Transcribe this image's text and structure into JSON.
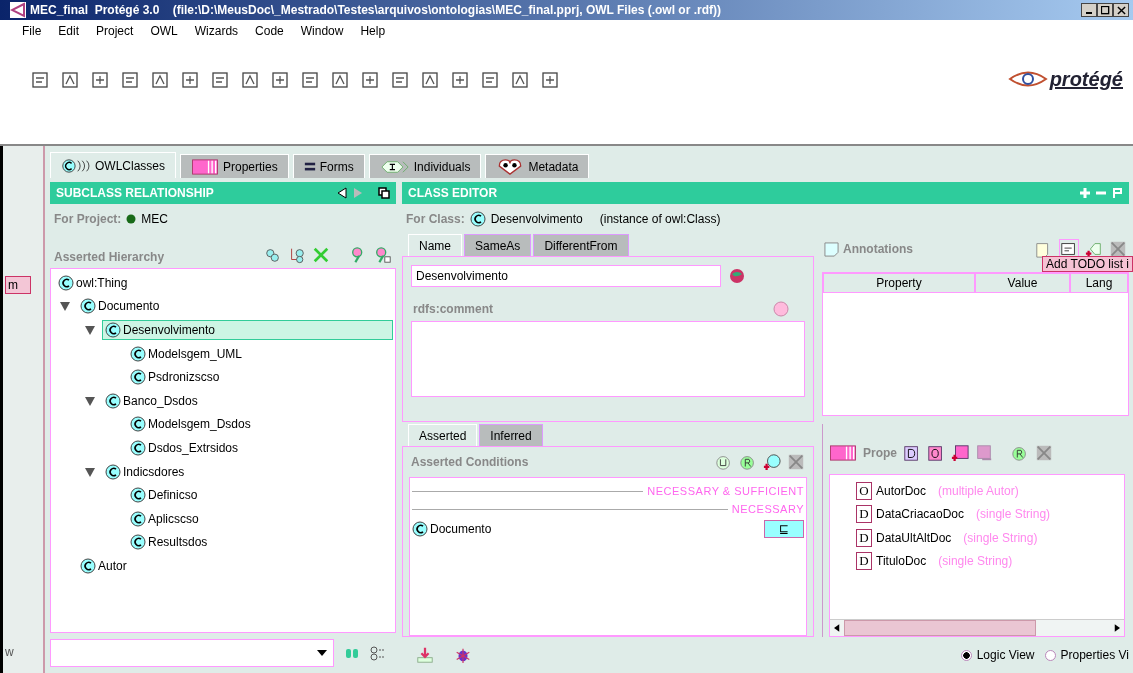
{
  "window": {
    "title": "MEC_final  Protégé 3.0    (file:\\D:\\MeusDoc\\_Mestrado\\Testes\\arquivos\\ontologias\\MEC_final.pprj, OWL Files (.owl or .rdf))"
  },
  "menu": [
    "File",
    "Edit",
    "Project",
    "OWL",
    "Wizards",
    "Code",
    "Window",
    "Help"
  ],
  "logo": "protégé",
  "left_strip": {
    "tag": "m",
    "text": "w"
  },
  "tabs": [
    {
      "label": "OWLClasses",
      "kind": "classes",
      "selected": true
    },
    {
      "label": "Properties",
      "kind": "properties",
      "selected": false
    },
    {
      "label": "Forms",
      "kind": "forms",
      "selected": false
    },
    {
      "label": "Individuals",
      "kind": "individuals",
      "selected": false
    },
    {
      "label": "Metadata",
      "kind": "metadata",
      "selected": false
    }
  ],
  "subclass_panel": {
    "title": "SUBCLASS RELATIONSHIP",
    "for_project_label": "For Project:",
    "project": "MEC",
    "hierarchy_label": "Asserted Hierarchy",
    "tree": [
      {
        "label": "owl:Thing",
        "selected": false,
        "children": [
          {
            "label": "Documento",
            "expanded": true,
            "selected": false,
            "children": [
              {
                "label": "Desenvolvimento",
                "expanded": true,
                "selected": true,
                "children": [
                  {
                    "label": "Modelsgem_UML",
                    "selected": false
                  },
                  {
                    "label": "Psdronizscso",
                    "selected": false
                  }
                ]
              },
              {
                "label": "Banco_Dsdos",
                "expanded": true,
                "selected": false,
                "children": [
                  {
                    "label": "Modelsgem_Dsdos",
                    "selected": false
                  },
                  {
                    "label": "Dsdos_Extrsidos",
                    "selected": false
                  }
                ]
              },
              {
                "label": "Indicsdores",
                "expanded": true,
                "selected": false,
                "children": [
                  {
                    "label": "Definicso",
                    "selected": false
                  },
                  {
                    "label": "Aplicscso",
                    "selected": false
                  },
                  {
                    "label": "Resultsdos",
                    "selected": false
                  }
                ]
              }
            ]
          },
          {
            "label": "Autor",
            "selected": false
          }
        ]
      }
    ]
  },
  "class_editor": {
    "title": "CLASS EDITOR",
    "for_class_label": "For Class:",
    "class_name": "Desenvolvimento",
    "class_type": "(instance of owl:Class)",
    "name_tabs": [
      {
        "label": "Name",
        "selected": true
      },
      {
        "label": "SameAs",
        "selected": false
      },
      {
        "label": "DifferentFrom",
        "selected": false
      }
    ],
    "name_value": "Desenvolvimento",
    "comment_label": "rdfs:comment",
    "annotations": {
      "title": "Annotations",
      "columns": [
        "Property",
        "Value",
        "Lang"
      ],
      "tooltip": "Add TODO list i"
    },
    "condition_tabs": [
      {
        "label": "Asserted",
        "selected": true
      },
      {
        "label": "Inferred",
        "selected": false
      }
    ],
    "conditions": {
      "title": "Asserted Conditions",
      "sections": [
        "NECESSARY & SUFFICIENT",
        "NECESSARY"
      ],
      "rows": [
        {
          "label": "Documento",
          "operator": "⊑"
        }
      ]
    },
    "properties": {
      "title": "Prope",
      "items": [
        {
          "type": "O",
          "name": "AutorDoc",
          "detail": "(multiple Autor)"
        },
        {
          "type": "D",
          "name": "DataCriacaoDoc",
          "detail": "(single String)"
        },
        {
          "type": "D",
          "name": "DataUltAltDoc",
          "detail": "(single String)"
        },
        {
          "type": "D",
          "name": "TituloDoc",
          "detail": "(single String)"
        }
      ]
    },
    "views": [
      {
        "label": "Logic View",
        "selected": true
      },
      {
        "label": "Properties Vi",
        "selected": false
      }
    ]
  }
}
